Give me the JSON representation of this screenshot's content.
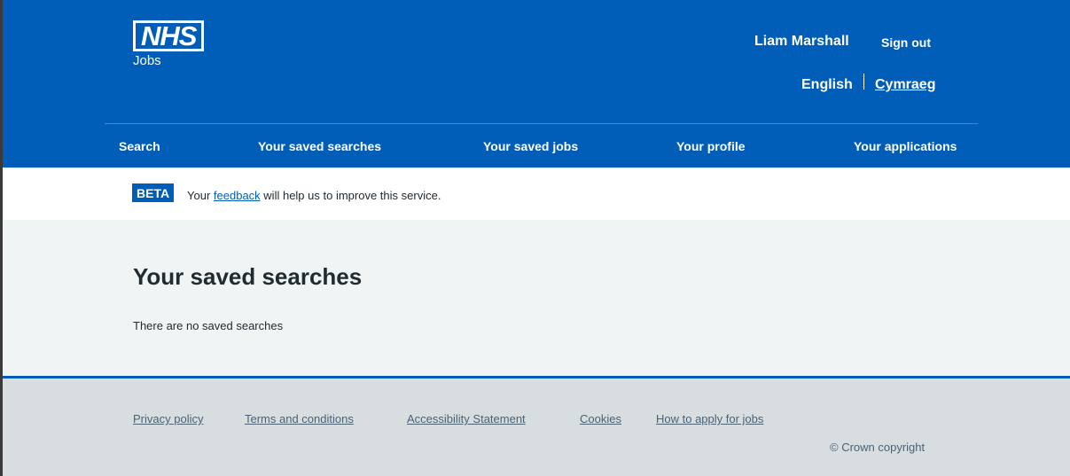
{
  "header": {
    "logo_text": "NHS",
    "logo_subtitle": "Jobs",
    "user_name": "Liam Marshall",
    "sign_out": "Sign out",
    "lang_english": "English",
    "lang_welsh": "Cymraeg",
    "brand_color": "#005eb8"
  },
  "nav": {
    "search": "Search",
    "saved_searches": "Your saved searches",
    "saved_jobs": "Your saved jobs",
    "profile": "Your profile",
    "applications": "Your applications"
  },
  "beta": {
    "tag": "BETA",
    "prefix": "Your",
    "link": "feedback",
    "suffix": "will help us to improve this service."
  },
  "main": {
    "title": "Your saved searches",
    "empty_message": "There are no saved searches"
  },
  "footer": {
    "privacy": "Privacy policy",
    "terms": "Terms and conditions",
    "accessibility": "Accessibility Statement",
    "cookies": "Cookies",
    "how_to_apply": "How to apply for jobs",
    "copyright": "© Crown copyright"
  }
}
